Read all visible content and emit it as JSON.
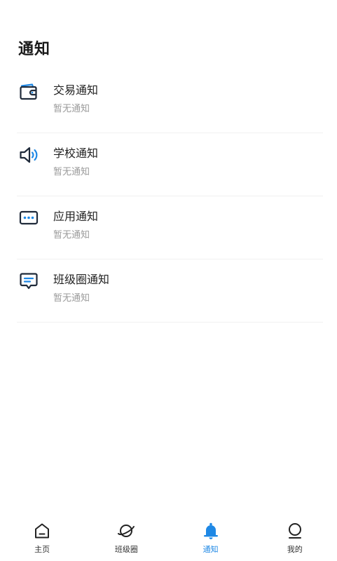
{
  "header": {
    "title": "通知"
  },
  "notices": [
    {
      "title": "交易通知",
      "subtitle": "暂无通知",
      "icon": "wallet-icon"
    },
    {
      "title": "学校通知",
      "subtitle": "暂无通知",
      "icon": "speaker-icon"
    },
    {
      "title": "应用通知",
      "subtitle": "暂无通知",
      "icon": "app-dots-icon"
    },
    {
      "title": "班级圈通知",
      "subtitle": "暂无通知",
      "icon": "message-icon"
    }
  ],
  "tabbar": {
    "items": [
      {
        "label": "主页",
        "icon": "home-icon",
        "active": false
      },
      {
        "label": "班级圈",
        "icon": "planet-icon",
        "active": false
      },
      {
        "label": "通知",
        "icon": "bell-icon",
        "active": true
      },
      {
        "label": "我的",
        "icon": "profile-icon",
        "active": false
      }
    ]
  },
  "colors": {
    "accent": "#1e88e5",
    "icon_dark": "#1f2a3a",
    "text_primary": "#222222",
    "text_secondary": "#9a9a9a",
    "divider": "#f1f1f1"
  }
}
